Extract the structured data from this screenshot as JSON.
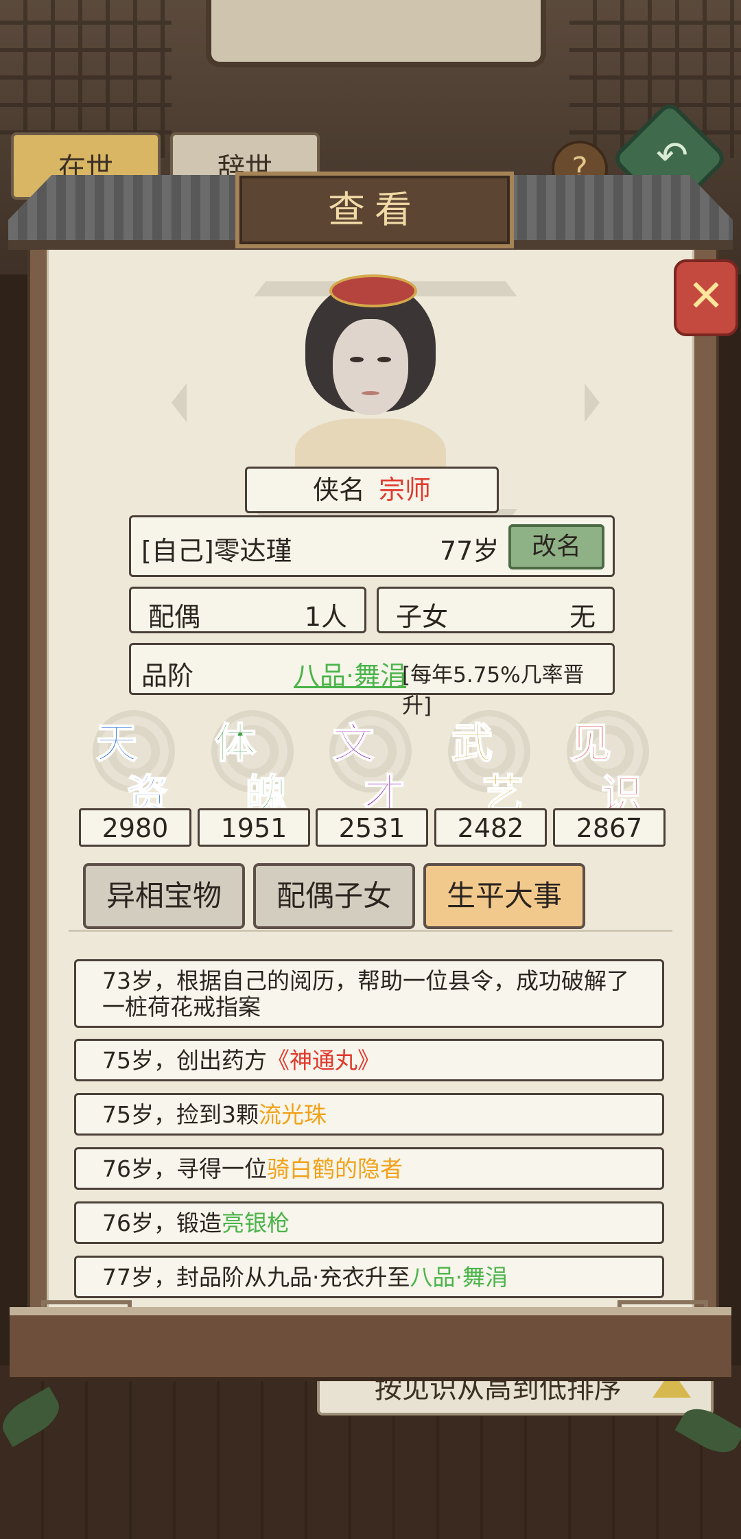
{
  "background": {
    "tabs": [
      "在世",
      "辞世"
    ],
    "help": "?",
    "sort_label": "按见识从高到低排序"
  },
  "modal": {
    "title": "查看",
    "nickname_label": "侠名",
    "nickname_value": "宗师",
    "name": "[自己]零达瑾",
    "age": "77岁",
    "rename_button": "改名",
    "spouse_label": "配偶",
    "spouse_value": "1人",
    "children_label": "子女",
    "children_value": "无",
    "rank_label": "品阶",
    "rank_value": "八品·舞涓",
    "rank_chance": "[每年5.75%几率晋升]",
    "stats": [
      {
        "c1": "天",
        "c2": "资",
        "value": "2980",
        "color": "#2f6fd8"
      },
      {
        "c1": "体",
        "c2": "魄",
        "value": "1951",
        "color": "#43a047"
      },
      {
        "c1": "文",
        "c2": "才",
        "value": "2531",
        "color": "#9b3fc4"
      },
      {
        "c1": "武",
        "c2": "艺",
        "value": "2482",
        "color": "#caa02e"
      },
      {
        "c1": "见",
        "c2": "识",
        "value": "2867",
        "color": "#d9534f"
      }
    ],
    "tabs": [
      "异相宝物",
      "配偶子女",
      "生平大事"
    ],
    "events": [
      {
        "text": "73岁，根据自己的阅历，帮助一位县令，成功破解了一桩荷花戒指案",
        "hl": ""
      },
      {
        "text": "75岁，创出药方",
        "hl": "《神通丸》"
      },
      {
        "text": "75岁，捡到3颗",
        "hl": "流光珠"
      },
      {
        "text": "76岁，寻得一位",
        "hl": "骑白鹤的隐者"
      },
      {
        "text": "76岁，锻造",
        "hl": "亮银枪"
      },
      {
        "text": "77岁，封品阶从九品·充衣升至",
        "hl": "八品·舞涓"
      }
    ]
  },
  "colors": {
    "highlight_red": "#e03a2e",
    "highlight_orange": "#f0a21a",
    "highlight_green": "#4bb44a"
  }
}
